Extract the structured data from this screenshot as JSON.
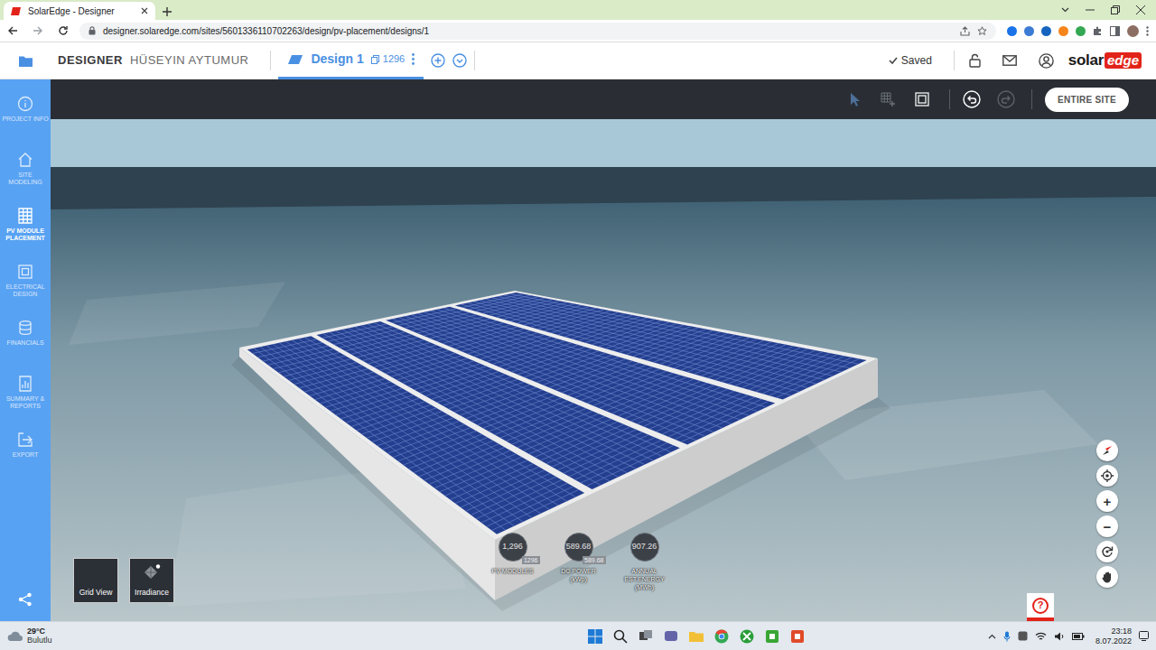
{
  "browser": {
    "tab_title": "SolarEdge - Designer",
    "url": "designer.solaredge.com/sites/5601336110702263/design/pv-placement/designs/1"
  },
  "header": {
    "section": "DESIGNER",
    "user": "HÜSEYIN AYTUMUR",
    "design_tabs": [
      {
        "label": "Design 1",
        "count": "1296",
        "selected": true
      }
    ],
    "status": "Saved",
    "logo": {
      "first": "solar",
      "second": "edge"
    }
  },
  "sidebar": {
    "items": [
      {
        "label": "PROJECT INFO",
        "selected": false
      },
      {
        "label": "SITE MODELING",
        "selected": false
      },
      {
        "label": "PV MODULE PLACEMENT",
        "selected": true
      },
      {
        "label": "ELECTRICAL DESIGN",
        "selected": false
      },
      {
        "label": "FINANCIALS",
        "selected": false
      },
      {
        "label": "SUMMARY & REPORTS",
        "selected": false
      },
      {
        "label": "EXPORT",
        "selected": false
      }
    ]
  },
  "toolbar": {
    "button": "ENTIRE SITE"
  },
  "stats": [
    {
      "value": "1,296",
      "sub": "1296",
      "label": "PV MODULES"
    },
    {
      "value": "589.68",
      "sub": "589.68",
      "label": "DC POWER (kWp)"
    },
    {
      "value": "907.26",
      "label": "ANNUAL EST.ENERGY (MWh)"
    }
  ],
  "view_buttons": [
    "Grid View",
    "Irradiance"
  ],
  "map_controls": {
    "zoom_in": "+",
    "zoom_out": "−"
  },
  "help": "?",
  "taskbar": {
    "temperature": "29°C",
    "weather": "Bulutlu",
    "time": "23:18",
    "date": "8.07.2022"
  }
}
